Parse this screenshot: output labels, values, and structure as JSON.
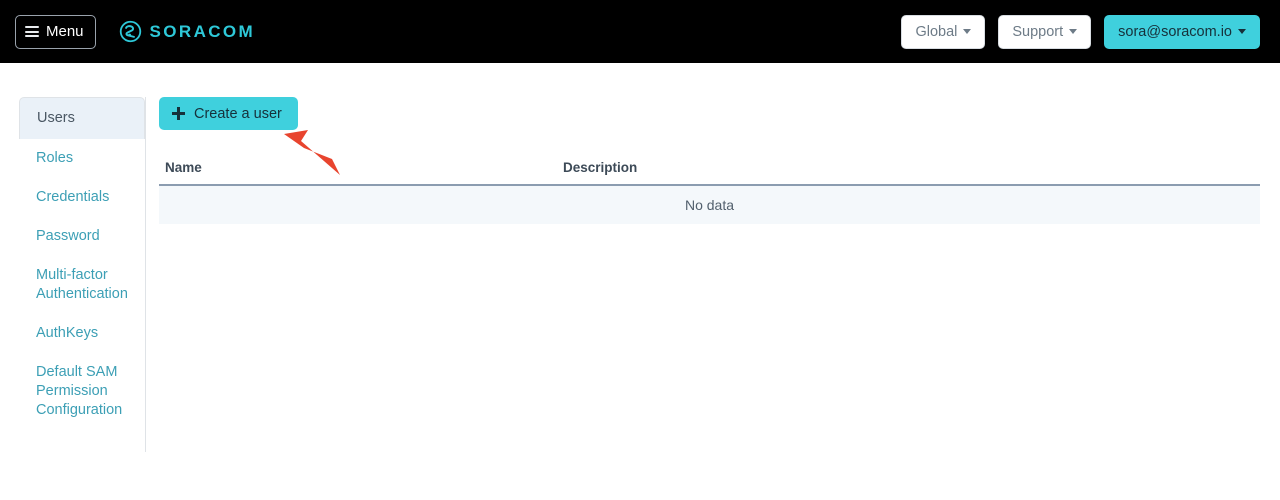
{
  "header": {
    "menu_button_label": "Menu",
    "menu_icon": "hamburger-icon",
    "brand_name": "SORACOM",
    "brand_icon": "soracom-logo-icon",
    "region_button_label": "Global",
    "support_button_label": "Support",
    "account_button_label": "sora@soracom.io",
    "caret_icon": "chevron-down-icon",
    "background_color": "#000000",
    "brand_color": "#2ec8d8",
    "accent_color": "#3fd0dd"
  },
  "sidebar": {
    "items": [
      {
        "label": "Users",
        "active": true
      },
      {
        "label": "Roles",
        "active": false
      },
      {
        "label": "Credentials",
        "active": false
      },
      {
        "label": "Password",
        "active": false
      },
      {
        "label": "Multi-factor Authentication",
        "active": false
      },
      {
        "label": "AuthKeys",
        "active": false
      },
      {
        "label": "Default SAM Permission Configuration",
        "active": false
      }
    ],
    "link_color": "#3c9fb5",
    "active_background": "#eaf1f8"
  },
  "main": {
    "create_button_label": "Create a user",
    "create_button_icon": "plus-icon",
    "table": {
      "columns": [
        "Name",
        "Description"
      ],
      "rows": [],
      "empty_message": "No data"
    }
  },
  "annotation": {
    "type": "arrow",
    "color": "#e8442e",
    "points_to": "create-a-user-button"
  }
}
